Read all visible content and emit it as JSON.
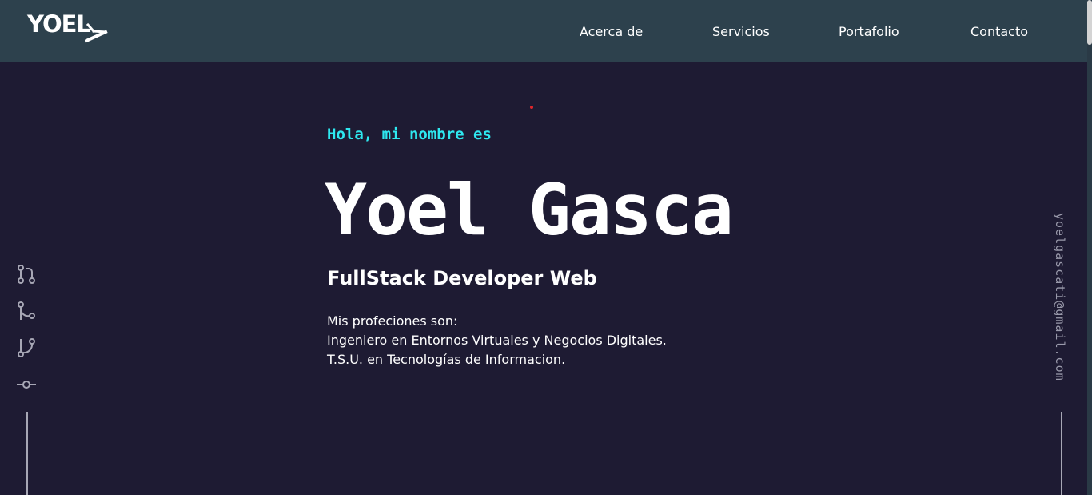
{
  "header": {
    "logo_text": "YOEL",
    "nav": [
      {
        "label": "Acerca de"
      },
      {
        "label": "Servicios"
      },
      {
        "label": "Portafolio"
      },
      {
        "label": "Contacto"
      }
    ]
  },
  "hero": {
    "greeting": "Hola, mi nombre es",
    "name": "Yoel Gasca",
    "role": "FullStack Developer Web",
    "bio": [
      "Mis profeciones son:",
      "Ingeniero en Entornos Virtuales y Negocios Digitales.",
      "T.S.U. en Tecnologías de Informacion."
    ]
  },
  "sidebar": {
    "icons": [
      {
        "name": "git-pull-request-icon"
      },
      {
        "name": "git-merge-icon"
      },
      {
        "name": "git-branch-icon"
      },
      {
        "name": "git-commit-icon"
      }
    ],
    "email": "yoelgascati@gmail.com"
  },
  "colors": {
    "header_bg": "#2d414d",
    "page_bg": "#1e1b33",
    "accent": "#2ee8f0",
    "text": "#ffffff",
    "muted": "#9a9aab"
  }
}
